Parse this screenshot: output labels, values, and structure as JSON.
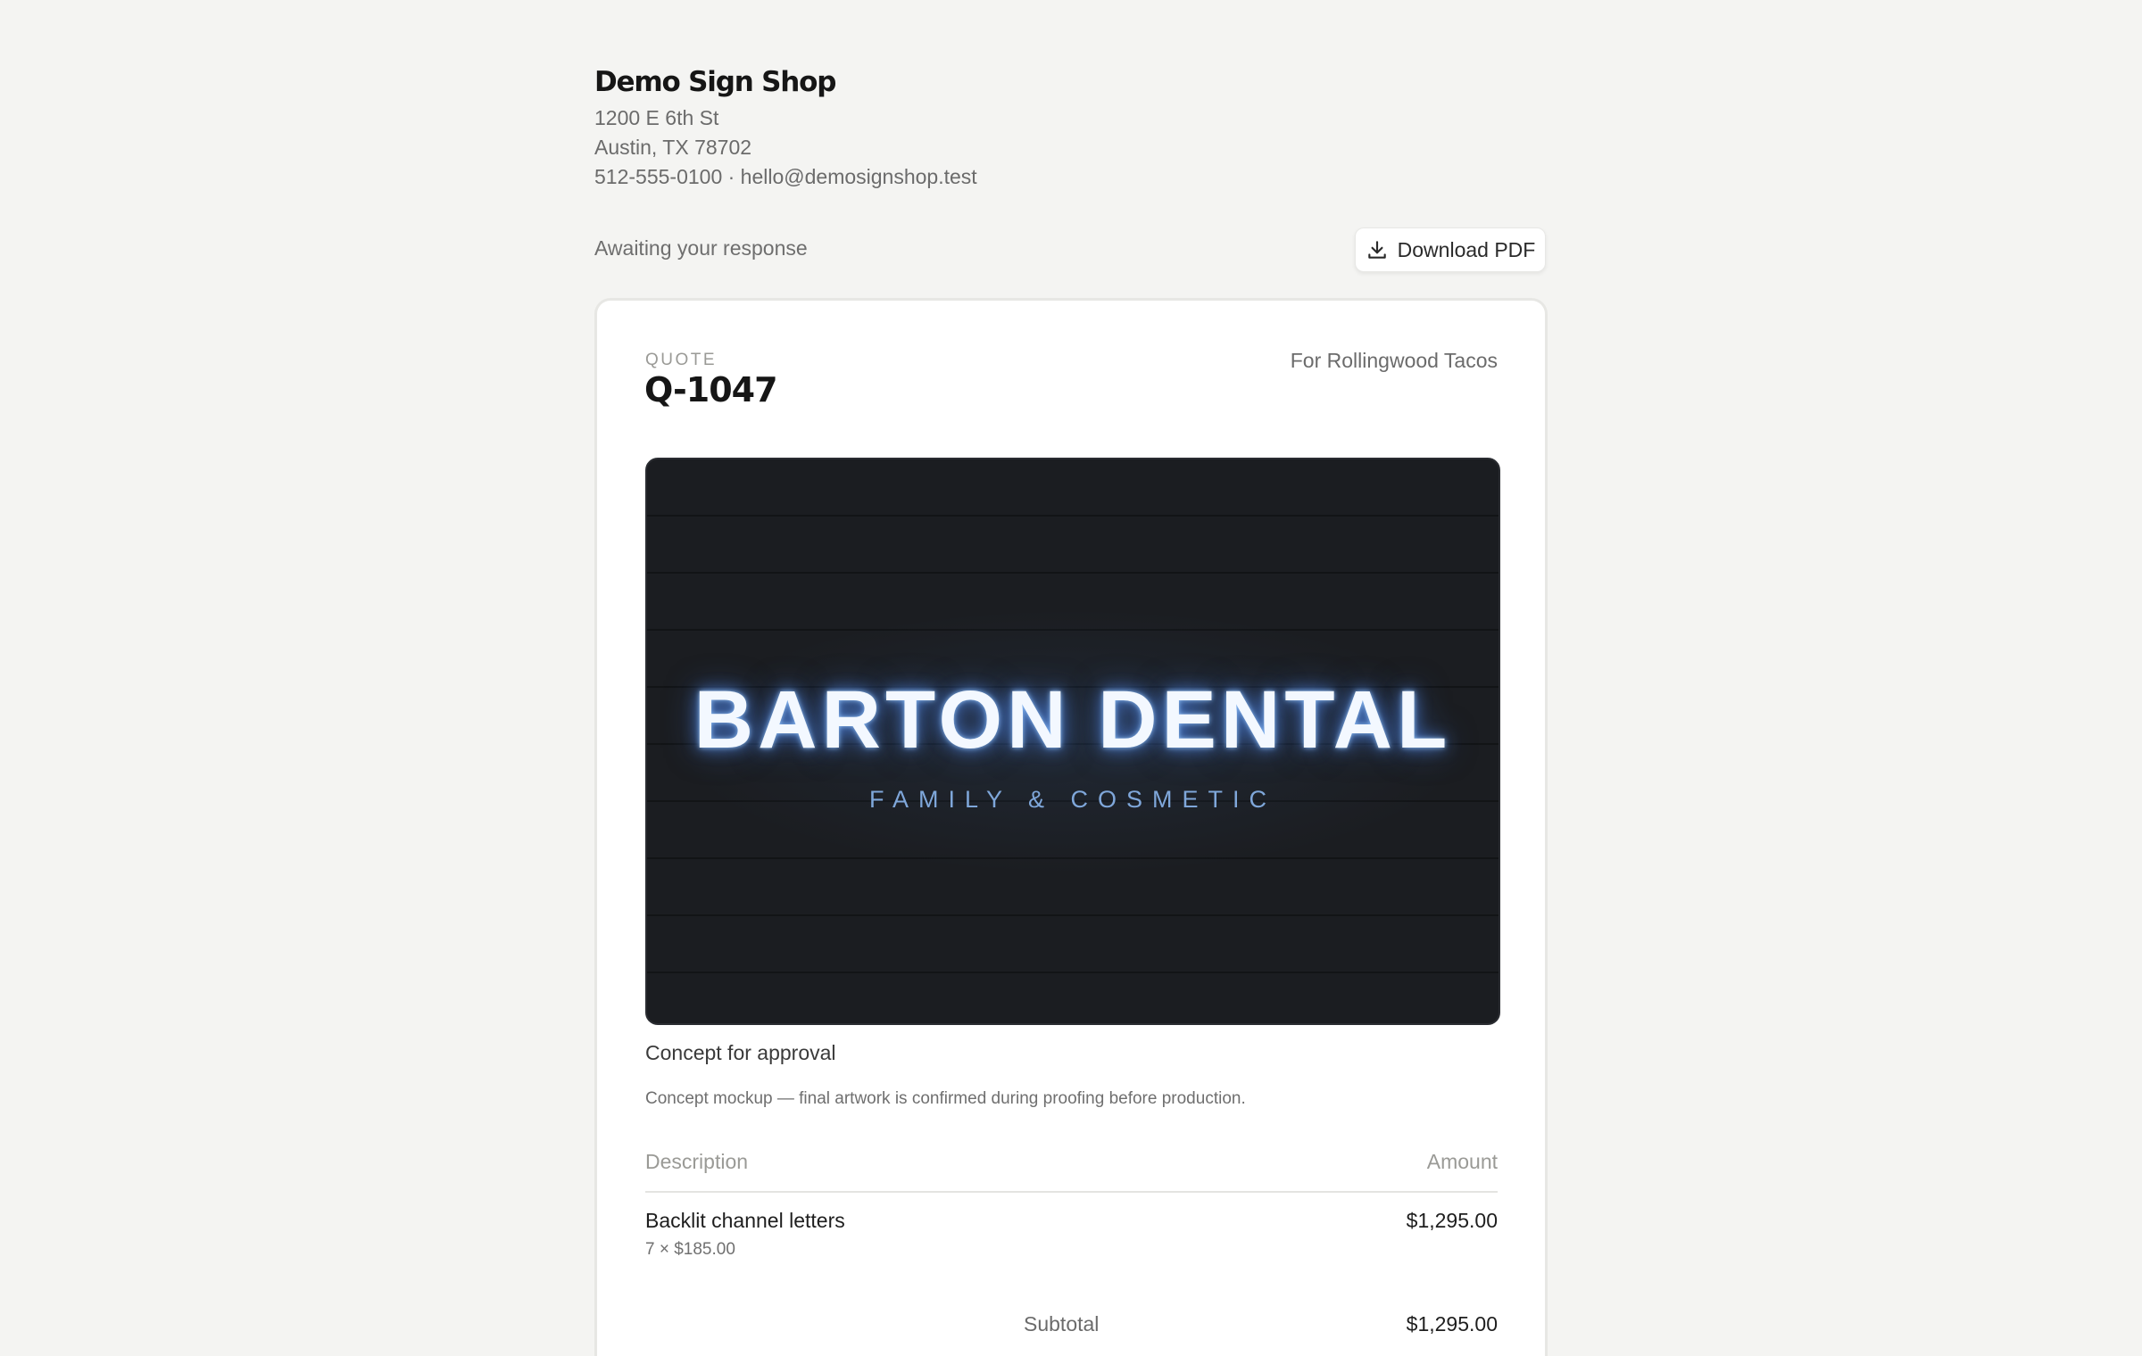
{
  "shop": {
    "name": "Demo Sign Shop",
    "address1": "1200 E 6th St",
    "address2": "Austin, TX 78702",
    "contact": "512-555-0100 · hello@demosignshop.test"
  },
  "status": "Awaiting your response",
  "download_button": {
    "label": "Download PDF",
    "icon": "download-icon"
  },
  "quote": {
    "label": "QUOTE",
    "number": "Q-1047",
    "client": "For Rollingwood Tacos"
  },
  "mockup": {
    "sign_text": "BARTON DENTAL",
    "sign_subtext": "FAMILY & COSMETIC",
    "caption": "Concept for approval",
    "note": "Concept mockup — final artwork is confirmed during proofing before production.",
    "colors": {
      "background": "#1b1d21",
      "glow": "#5a96ff",
      "subtext": "#7fa7da"
    }
  },
  "table": {
    "headers": {
      "description": "Description",
      "amount": "Amount"
    },
    "items": [
      {
        "description": "Backlit channel letters",
        "detail": "7 × $185.00",
        "amount": "$1,295.00"
      }
    ]
  },
  "totals": {
    "subtotal_label": "Subtotal",
    "subtotal_value": "$1,295.00"
  }
}
